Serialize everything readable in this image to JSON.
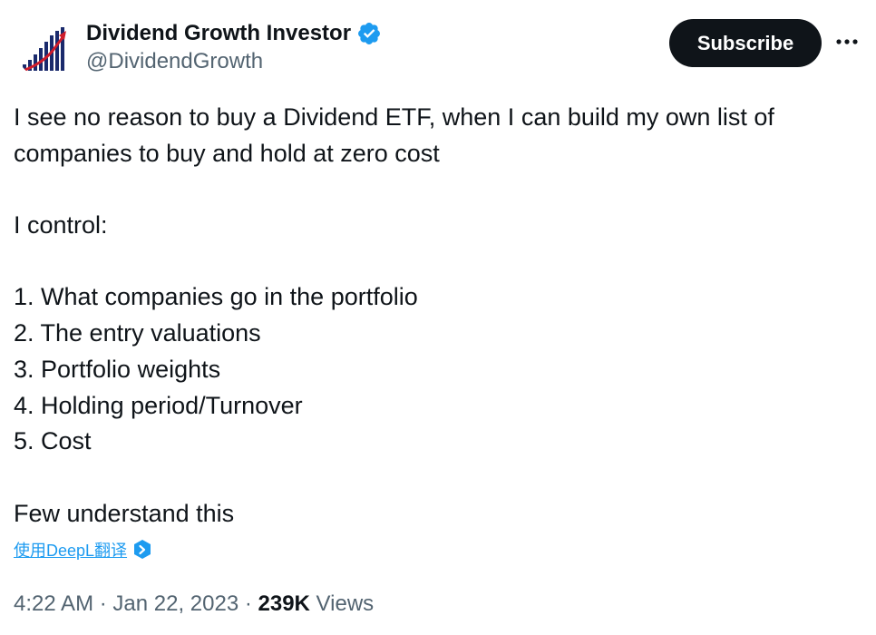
{
  "author": {
    "display_name": "Dividend Growth Investor",
    "handle": "@DividendGrowth",
    "avatar_icon": "growth-chart-logo-icon",
    "verified_icon": "verified-badge-icon",
    "verified_color": "#1d9bf0"
  },
  "actions": {
    "subscribe_label": "Subscribe",
    "more_icon": "more-options-icon"
  },
  "tweet": {
    "lines": [
      "I see no reason to buy a Dividend ETF, when I can build my own list of",
      "companies to buy and hold at zero cost",
      "",
      "I control:",
      "",
      "1. What companies go in the portfolio",
      "2. The entry valuations",
      "3. Portfolio weights",
      "4. Holding period/Turnover",
      "5. Cost",
      "",
      "Few understand this"
    ]
  },
  "translate": {
    "label": "使用DeepL翻译",
    "icon": "deepl-icon",
    "color": "#1d9bf0"
  },
  "meta": {
    "time": "4:22 AM",
    "separator": " · ",
    "date": "Jan 22, 2023",
    "views_count": "239K",
    "views_label": " Views"
  },
  "colors": {
    "text": "#0f1419",
    "secondary": "#536471",
    "button_bg": "#0f1419"
  }
}
